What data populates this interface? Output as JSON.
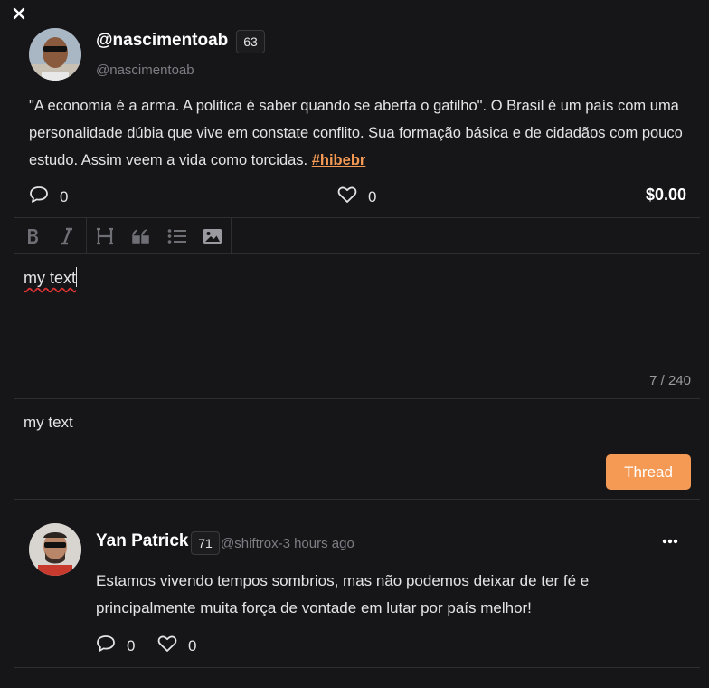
{
  "post": {
    "display_name": "@nascimentoab",
    "score": "63",
    "handle": "@nascimentoab",
    "body": "\"A economia é a arma. A politica é saber quando se aberta o gatilho\". O Brasil é um país com uma personalidade dúbia que vive em constate conflito. Sua formação básica e de cidadãos com pouco estudo. Assim veem a vida como torcidas. ",
    "hashtag": "#hibebr",
    "comments": "0",
    "likes": "0",
    "value": "$0.00"
  },
  "editor": {
    "toolbar": [
      "bold-icon",
      "italic-icon",
      "heading-icon",
      "quote-icon",
      "list-icon",
      "image-icon"
    ],
    "text": "my text",
    "counter": "7 / 240",
    "preview": "my text",
    "submit_label": "Thread"
  },
  "reply": {
    "display_name": "Yan Patrick",
    "score": "71",
    "handle_time": "@shiftrox-3 hours ago",
    "body": "Estamos vivendo tempos sombrios, mas não podemos deixar de ter fé e principalmente muita força de vontade em lutar por país melhor!",
    "comments": "0",
    "likes": "0"
  },
  "colors": {
    "background": "#161618",
    "accent": "#f59a55",
    "divider": "#2e2e32"
  }
}
